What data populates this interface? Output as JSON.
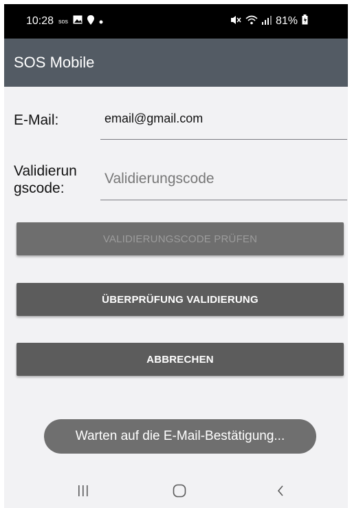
{
  "status_bar": {
    "time": "10:28",
    "battery": "81%",
    "icons": [
      "sos-icon",
      "gallery-icon",
      "location-pin-icon",
      "dot-icon",
      "mute-icon",
      "wifi-icon",
      "signal-icon",
      "battery-icon"
    ]
  },
  "app": {
    "title": "SOS Mobile"
  },
  "form": {
    "email_label": "E-Mail:",
    "email_value": "email@gmail.com",
    "code_label_line1": "Validierun",
    "code_label_line2": "gscode:",
    "code_placeholder": "Validierungscode"
  },
  "buttons": {
    "verify_code": "VALIDIERUNGSCODE PRÜFEN",
    "check_validation": "ÜBERPRÜFUNG VALIDIERUNG",
    "cancel": "ABBRECHEN"
  },
  "toast": {
    "message": "Warten auf die E-Mail-Bestätigung..."
  },
  "colors": {
    "app_bar": "#535b64",
    "background": "#f2f2f4",
    "button": "#5c5c5c",
    "button_disabled": "#6e6e6e",
    "toast": "#6f6f6f"
  }
}
